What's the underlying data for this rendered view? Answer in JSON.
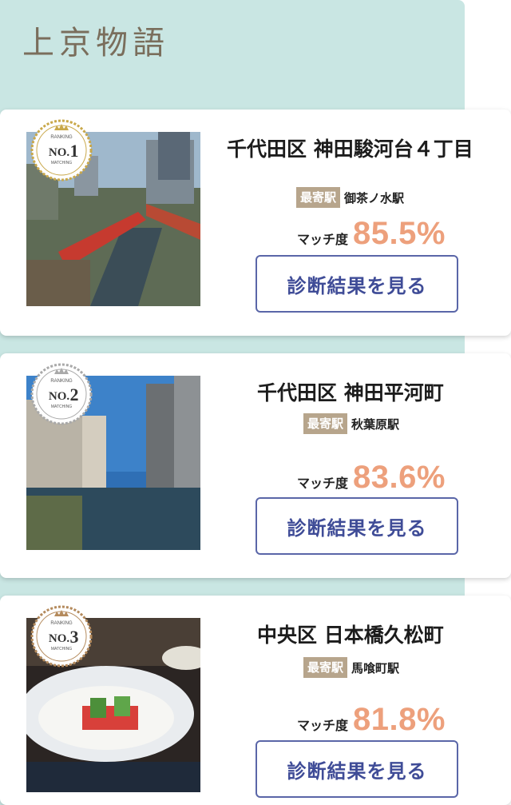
{
  "header": {
    "logo_text": "上京物語"
  },
  "cards": [
    {
      "rank_word": "RANKING",
      "rank_no": "NO.",
      "rank_num": "1",
      "rank_sub": "MATCHING",
      "title": "千代田区 神田駿河台４丁目",
      "station_tag": "最寄駅",
      "station": "御茶ノ水駅",
      "match_label": "マッチ度",
      "match_value": "85.5%",
      "button_label": "診断結果を見る",
      "badge_color": "#c9a84a"
    },
    {
      "rank_word": "RANKING",
      "rank_no": "NO.",
      "rank_num": "2",
      "rank_sub": "MATCHING",
      "title": "千代田区 神田平河町",
      "station_tag": "最寄駅",
      "station": "秋葉原駅",
      "match_label": "マッチ度",
      "match_value": "83.6%",
      "button_label": "診断結果を見る",
      "badge_color": "#a9a9a9"
    },
    {
      "rank_word": "RANKING",
      "rank_no": "NO.",
      "rank_num": "3",
      "rank_sub": "MATCHING",
      "title": "中央区 日本橋久松町",
      "station_tag": "最寄駅",
      "station": "馬喰町駅",
      "match_label": "マッチ度",
      "match_value": "81.8%",
      "button_label": "診断結果を見る",
      "badge_color": "#b48a5c"
    }
  ],
  "colors": {
    "mint_panel": "#c9e6e3",
    "station_tag_bg": "#b7a58c",
    "match_value": "#eda07c",
    "button_border": "#5a66a8",
    "button_text": "#3f4c97"
  }
}
